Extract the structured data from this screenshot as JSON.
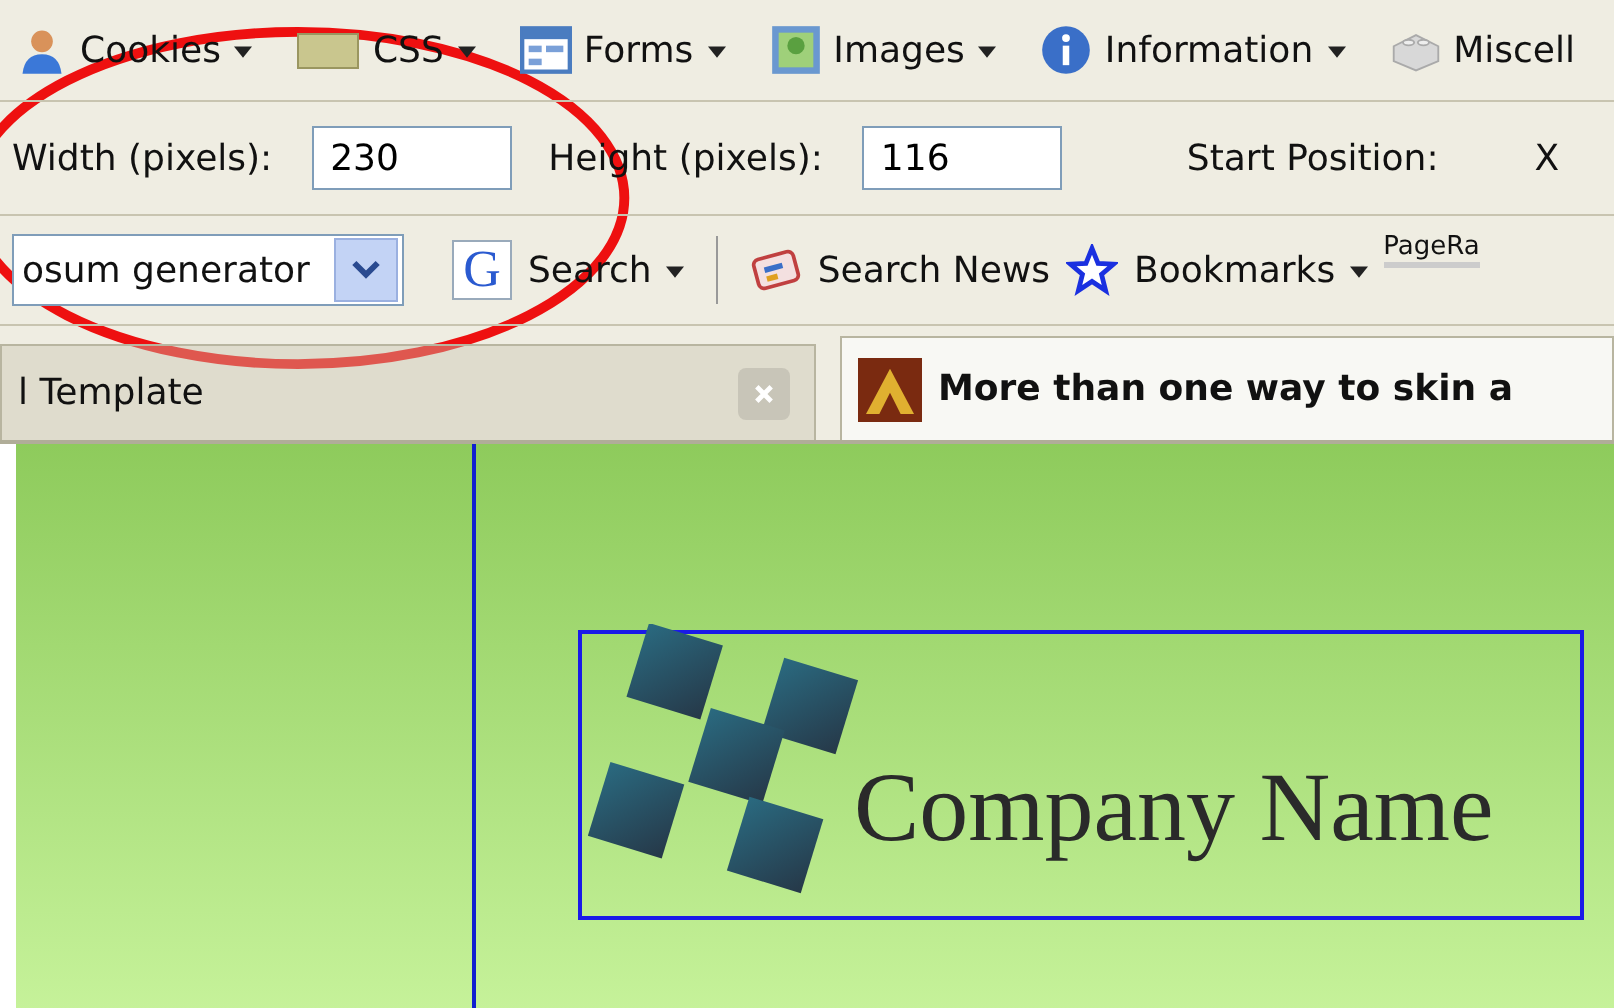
{
  "menu_toolbar": {
    "items": [
      {
        "label": "Cookies",
        "kind": "person",
        "dropdown": true
      },
      {
        "label": "CSS",
        "kind": "css",
        "dropdown": true
      },
      {
        "label": "Forms",
        "kind": "form",
        "dropdown": true
      },
      {
        "label": "Images",
        "kind": "image",
        "dropdown": true
      },
      {
        "label": "Information",
        "kind": "info",
        "dropdown": true
      },
      {
        "label": "Miscell",
        "kind": "brick",
        "dropdown": false
      }
    ]
  },
  "resize_toolbar": {
    "width": {
      "label": "Width (pixels):",
      "value": "230"
    },
    "height": {
      "label": "Height (pixels):",
      "value": "116"
    },
    "start_position": {
      "label": "Start Position:"
    },
    "x_label": "X"
  },
  "search_toolbar": {
    "query": {
      "value": "osum generator"
    },
    "engine_logo": "G",
    "search": "Search",
    "search_news": "Search News",
    "bookmarks": "Bookmarks",
    "pagerank": "PageRa"
  },
  "tabs": [
    {
      "title": "l Template",
      "selected": false
    },
    {
      "title": "More than one way to skin a",
      "selected": true
    }
  ],
  "page": {
    "logo": {
      "text": "Company Name"
    }
  }
}
